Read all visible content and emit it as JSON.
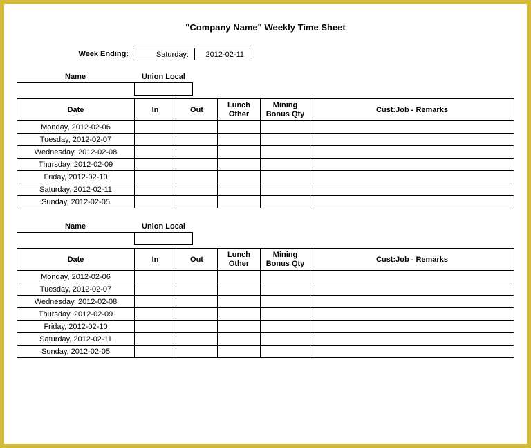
{
  "title": "\"Company Name\" Weekly Time Sheet",
  "week_ending": {
    "label": "Week Ending:",
    "day": "Saturday:",
    "date": "2012-02-11"
  },
  "sections": [
    {
      "name_label": "Name",
      "union_label": "Union Local",
      "headers": {
        "date": "Date",
        "in": "In",
        "out": "Out",
        "lunch_line1": "Lunch",
        "lunch_line2": "Other",
        "bonus_line1": "Mining",
        "bonus_line2": "Bonus Qty",
        "remarks": "Cust:Job - Remarks"
      },
      "rows": [
        {
          "date": "Monday, 2012-02-06",
          "in": "",
          "out": "",
          "lunch": "",
          "bonus": "",
          "remarks": ""
        },
        {
          "date": "Tuesday, 2012-02-07",
          "in": "",
          "out": "",
          "lunch": "",
          "bonus": "",
          "remarks": ""
        },
        {
          "date": "Wednesday, 2012-02-08",
          "in": "",
          "out": "",
          "lunch": "",
          "bonus": "",
          "remarks": ""
        },
        {
          "date": "Thursday, 2012-02-09",
          "in": "",
          "out": "",
          "lunch": "",
          "bonus": "",
          "remarks": ""
        },
        {
          "date": "Friday, 2012-02-10",
          "in": "",
          "out": "",
          "lunch": "",
          "bonus": "",
          "remarks": ""
        },
        {
          "date": "Saturday, 2012-02-11",
          "in": "",
          "out": "",
          "lunch": "",
          "bonus": "",
          "remarks": ""
        },
        {
          "date": "Sunday, 2012-02-05",
          "in": "",
          "out": "",
          "lunch": "",
          "bonus": "",
          "remarks": ""
        }
      ]
    },
    {
      "name_label": "Name",
      "union_label": "Union Local",
      "headers": {
        "date": "Date",
        "in": "In",
        "out": "Out",
        "lunch_line1": "Lunch",
        "lunch_line2": "Other",
        "bonus_line1": "Mining",
        "bonus_line2": "Bonus Qty",
        "remarks": "Cust:Job - Remarks"
      },
      "rows": [
        {
          "date": "Monday, 2012-02-06",
          "in": "",
          "out": "",
          "lunch": "",
          "bonus": "",
          "remarks": ""
        },
        {
          "date": "Tuesday, 2012-02-07",
          "in": "",
          "out": "",
          "lunch": "",
          "bonus": "",
          "remarks": ""
        },
        {
          "date": "Wednesday, 2012-02-08",
          "in": "",
          "out": "",
          "lunch": "",
          "bonus": "",
          "remarks": ""
        },
        {
          "date": "Thursday, 2012-02-09",
          "in": "",
          "out": "",
          "lunch": "",
          "bonus": "",
          "remarks": ""
        },
        {
          "date": "Friday, 2012-02-10",
          "in": "",
          "out": "",
          "lunch": "",
          "bonus": "",
          "remarks": ""
        },
        {
          "date": "Saturday, 2012-02-11",
          "in": "",
          "out": "",
          "lunch": "",
          "bonus": "",
          "remarks": ""
        },
        {
          "date": "Sunday, 2012-02-05",
          "in": "",
          "out": "",
          "lunch": "",
          "bonus": "",
          "remarks": ""
        }
      ]
    }
  ]
}
